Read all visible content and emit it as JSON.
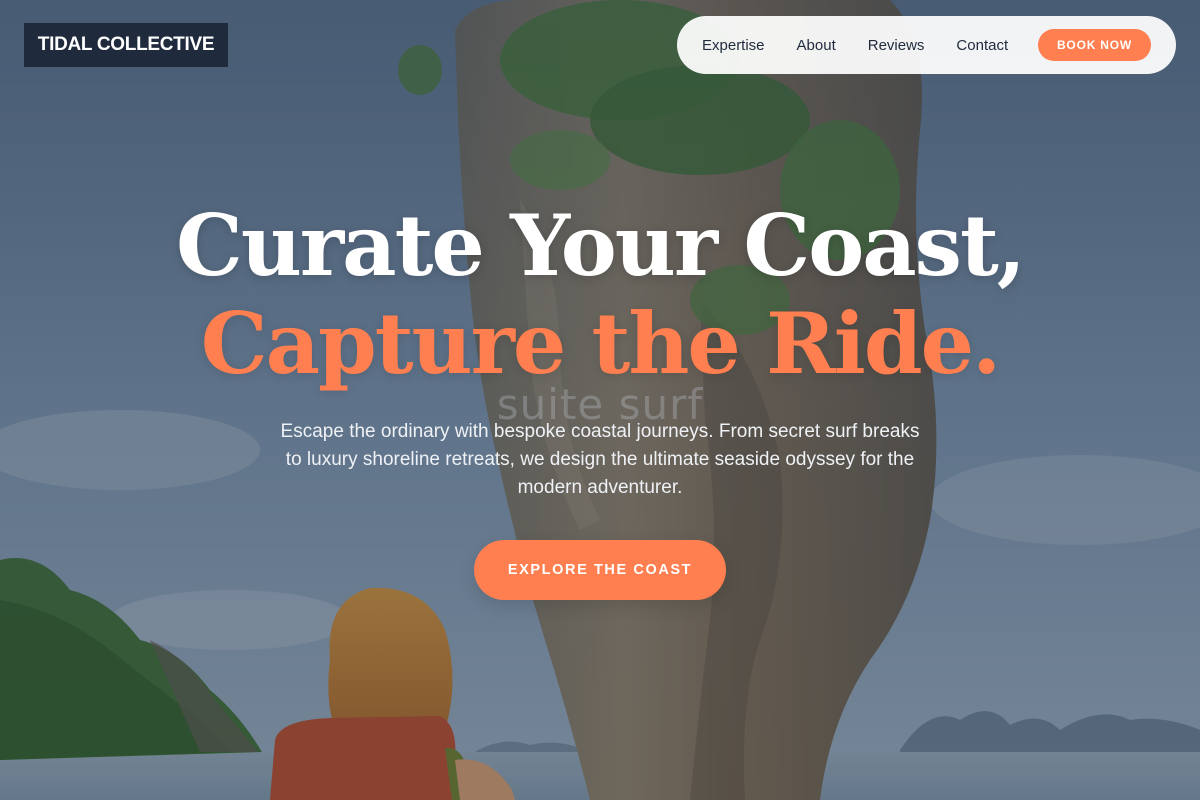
{
  "brand": {
    "logo_text": "TIDAL COLLECTIVE"
  },
  "nav": {
    "links": [
      "Expertise",
      "About",
      "Reviews",
      "Contact"
    ],
    "book_label": "BOOK NOW"
  },
  "hero": {
    "title_line1": "Curate Your Coast,",
    "title_line2": "Capture the Ride.",
    "ghost_text": "suite surf",
    "subtitle": "Escape the ordinary with bespoke coastal journeys. From secret surf breaks to luxury shoreline retreats, we design the ultimate seaside odyssey for the modern adventurer.",
    "cta_label": "EXPLORE THE COAST"
  },
  "colors": {
    "accent": "#ff7f50",
    "dark": "#1f2a3c",
    "nav_bg": "#ffffff"
  }
}
